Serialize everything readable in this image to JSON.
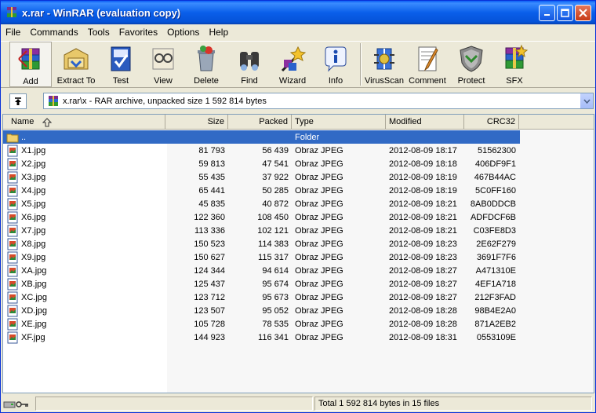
{
  "window": {
    "title": "x.rar - WinRAR (evaluation copy)"
  },
  "menu": [
    "File",
    "Commands",
    "Tools",
    "Favorites",
    "Options",
    "Help"
  ],
  "toolbar": [
    {
      "label": "Add",
      "icon": "add-archive-icon"
    },
    {
      "label": "Extract To",
      "icon": "extract-to-icon"
    },
    {
      "label": "Test",
      "icon": "test-icon"
    },
    {
      "label": "View",
      "icon": "view-icon"
    },
    {
      "label": "Delete",
      "icon": "delete-icon"
    },
    {
      "label": "Find",
      "icon": "find-icon"
    },
    {
      "label": "Wizard",
      "icon": "wizard-icon"
    },
    {
      "label": "Info",
      "icon": "info-icon"
    },
    {
      "label": "VirusScan",
      "icon": "virusscan-icon"
    },
    {
      "label": "Comment",
      "icon": "comment-icon"
    },
    {
      "label": "Protect",
      "icon": "protect-icon"
    },
    {
      "label": "SFX",
      "icon": "sfx-icon"
    }
  ],
  "address": {
    "text": "x.rar\\x - RAR archive, unpacked size 1 592 814 bytes"
  },
  "columns": {
    "name": "Name",
    "size": "Size",
    "packed": "Packed",
    "type": "Type",
    "modified": "Modified",
    "crc": "CRC32"
  },
  "parent_row": {
    "name": "..",
    "type": "Folder"
  },
  "files": [
    {
      "name": "X1.jpg",
      "size": "81 793",
      "packed": "56 439",
      "type": "Obraz JPEG",
      "modified": "2012-08-09 18:17",
      "crc": "51562300"
    },
    {
      "name": "X2.jpg",
      "size": "59 813",
      "packed": "47 541",
      "type": "Obraz JPEG",
      "modified": "2012-08-09 18:18",
      "crc": "406DF9F1"
    },
    {
      "name": "X3.jpg",
      "size": "55 435",
      "packed": "37 922",
      "type": "Obraz JPEG",
      "modified": "2012-08-09 18:19",
      "crc": "467B44AC"
    },
    {
      "name": "X4.jpg",
      "size": "65 441",
      "packed": "50 285",
      "type": "Obraz JPEG",
      "modified": "2012-08-09 18:19",
      "crc": "5C0FF160"
    },
    {
      "name": "X5.jpg",
      "size": "45 835",
      "packed": "40 872",
      "type": "Obraz JPEG",
      "modified": "2012-08-09 18:21",
      "crc": "8AB0DDCB"
    },
    {
      "name": "X6.jpg",
      "size": "122 360",
      "packed": "108 450",
      "type": "Obraz JPEG",
      "modified": "2012-08-09 18:21",
      "crc": "ADFDCF6B"
    },
    {
      "name": "X7.jpg",
      "size": "113 336",
      "packed": "102 121",
      "type": "Obraz JPEG",
      "modified": "2012-08-09 18:21",
      "crc": "C03FE8D3"
    },
    {
      "name": "X8.jpg",
      "size": "150 523",
      "packed": "114 383",
      "type": "Obraz JPEG",
      "modified": "2012-08-09 18:23",
      "crc": "2E62F279"
    },
    {
      "name": "X9.jpg",
      "size": "150 627",
      "packed": "115 317",
      "type": "Obraz JPEG",
      "modified": "2012-08-09 18:23",
      "crc": "3691F7F6"
    },
    {
      "name": "XA.jpg",
      "size": "124 344",
      "packed": "94 614",
      "type": "Obraz JPEG",
      "modified": "2012-08-09 18:27",
      "crc": "A471310E"
    },
    {
      "name": "XB.jpg",
      "size": "125 437",
      "packed": "95 674",
      "type": "Obraz JPEG",
      "modified": "2012-08-09 18:27",
      "crc": "4EF1A718"
    },
    {
      "name": "XC.jpg",
      "size": "123 712",
      "packed": "95 673",
      "type": "Obraz JPEG",
      "modified": "2012-08-09 18:27",
      "crc": "212F3FAD"
    },
    {
      "name": "XD.jpg",
      "size": "123 507",
      "packed": "95 052",
      "type": "Obraz JPEG",
      "modified": "2012-08-09 18:28",
      "crc": "98B4E2A0"
    },
    {
      "name": "XE.jpg",
      "size": "105 728",
      "packed": "78 535",
      "type": "Obraz JPEG",
      "modified": "2012-08-09 18:28",
      "crc": "871A2EB2"
    },
    {
      "name": "XF.jpg",
      "size": "144 923",
      "packed": "116 341",
      "type": "Obraz JPEG",
      "modified": "2012-08-09 18:31",
      "crc": "0553109E"
    }
  ],
  "status": {
    "total": "Total 1 592 814 bytes in 15 files"
  }
}
